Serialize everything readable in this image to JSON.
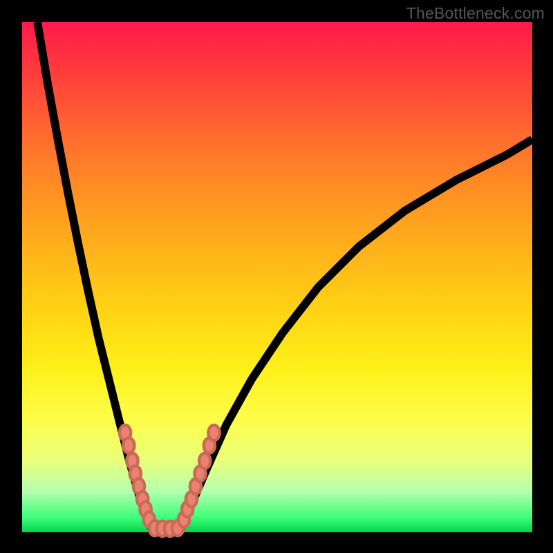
{
  "attribution": "TheBottleneck.com",
  "chart_data": {
    "type": "line",
    "title": "",
    "xlabel": "",
    "ylabel": "",
    "xlim": [
      0,
      100
    ],
    "ylim": [
      0,
      100
    ],
    "series": [
      {
        "name": "left-curve",
        "x": [
          3,
          5,
          7,
          9,
          11,
          13,
          15,
          17,
          19,
          21,
          23,
          24.5,
          25.5
        ],
        "values": [
          100,
          88,
          77,
          66.5,
          56.5,
          47,
          38,
          30,
          22,
          14,
          7,
          2.5,
          0.5
        ]
      },
      {
        "name": "right-curve",
        "x": [
          31,
          33,
          36,
          40,
          45,
          51,
          58,
          66,
          75,
          85,
          95,
          100
        ],
        "values": [
          0.5,
          5,
          12,
          21,
          30,
          39,
          48,
          56,
          63,
          69,
          74,
          77
        ]
      },
      {
        "name": "floor",
        "x": [
          25.5,
          31
        ],
        "values": [
          0.5,
          0.5
        ]
      }
    ],
    "beads_left": [
      {
        "x": 20.2,
        "y": 19.5
      },
      {
        "x": 20.9,
        "y": 17.0
      },
      {
        "x": 21.6,
        "y": 14.0
      },
      {
        "x": 22.2,
        "y": 11.5
      },
      {
        "x": 22.9,
        "y": 9.0
      },
      {
        "x": 23.6,
        "y": 6.5
      },
      {
        "x": 24.2,
        "y": 4.5
      },
      {
        "x": 24.9,
        "y": 2.5
      }
    ],
    "beads_bottom": [
      {
        "x": 26.0,
        "y": 0.8
      },
      {
        "x": 27.5,
        "y": 0.7
      },
      {
        "x": 29.0,
        "y": 0.7
      },
      {
        "x": 30.5,
        "y": 0.8
      }
    ],
    "beads_right": [
      {
        "x": 31.7,
        "y": 2.5
      },
      {
        "x": 32.4,
        "y": 4.5
      },
      {
        "x": 33.2,
        "y": 6.5
      },
      {
        "x": 34.0,
        "y": 9.0
      },
      {
        "x": 34.9,
        "y": 11.5
      },
      {
        "x": 35.8,
        "y": 14.0
      },
      {
        "x": 36.7,
        "y": 17.0
      },
      {
        "x": 37.6,
        "y": 19.5
      }
    ],
    "bead_rx": 1.1,
    "bead_ry": 1.5
  }
}
